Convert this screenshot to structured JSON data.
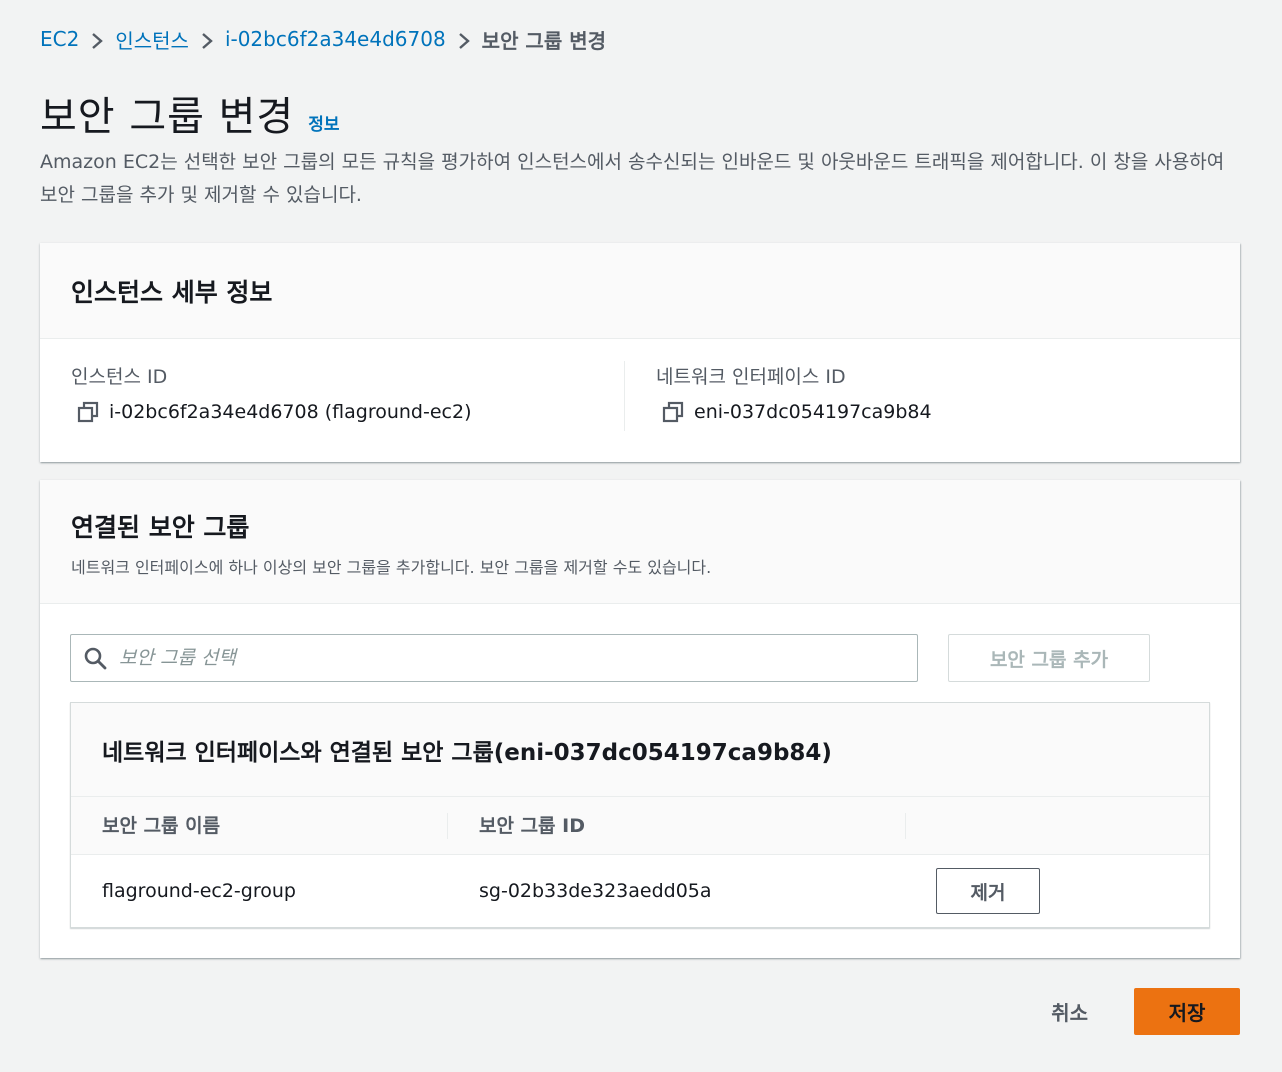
{
  "breadcrumb": {
    "items": [
      "EC2",
      "인스턴스",
      "i-02bc6f2a34e4d6708"
    ],
    "current": "보안 그룹 변경"
  },
  "page": {
    "title": "보안 그룹 변경",
    "info_link": "정보",
    "description": "Amazon EC2는 선택한 보안 그룹의 모든 규칙을 평가하여 인스턴스에서 송수신되는 인바운드 및 아웃바운드 트래픽을 제어합니다. 이 창을 사용하여 보안 그룹을 추가 및 제거할 수 있습니다."
  },
  "instance_details": {
    "title": "인스턴스 세부 정보",
    "instance_id_label": "인스턴스 ID",
    "instance_id_value": "i-02bc6f2a34e4d6708 (flaground-ec2)",
    "eni_label": "네트워크 인터페이스 ID",
    "eni_value": "eni-037dc054197ca9b84"
  },
  "security_groups": {
    "title": "연결된 보안 그룹",
    "description": "네트워크 인터페이스에 하나 이상의 보안 그룹을 추가합니다. 보안 그룹을 제거할 수도 있습니다.",
    "search_placeholder": "보안 그룹 선택",
    "add_button": "보안 그룹 추가",
    "table": {
      "title": "네트워크 인터페이스와 연결된 보안 그룹(eni-037dc054197ca9b84)",
      "columns": [
        "보안 그룹 이름",
        "보안 그룹 ID"
      ],
      "rows": [
        {
          "name": "flaground-ec2-group",
          "id": "sg-02b33de323aedd05a",
          "action": "제거"
        }
      ]
    }
  },
  "footer": {
    "cancel": "취소",
    "save": "저장"
  }
}
